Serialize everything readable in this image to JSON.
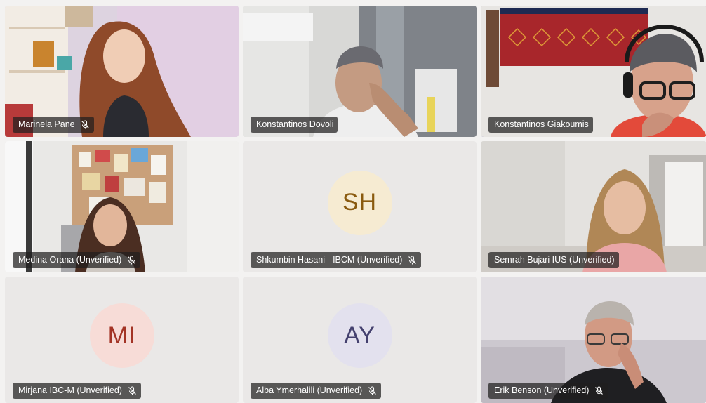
{
  "participants": [
    {
      "name": "Marinela Pane",
      "muted": true
    },
    {
      "name": "Konstantinos Dovoli",
      "muted": false
    },
    {
      "name": "Konstantinos Giakoumis",
      "muted": false,
      "active_speaker": true
    },
    {
      "name": "Medina Orana (Unverified)",
      "muted": true
    },
    {
      "name": "Shkumbin Hasani - IBCM (Unverified)",
      "muted": true,
      "initials": "SH",
      "avatar_bg": "#f6ebd2",
      "avatar_fg": "#8a5a0f"
    },
    {
      "name": "Semrah Bujari IUS (Unverified)",
      "muted": false
    },
    {
      "name": "Mirjana IBC-M (Unverified)",
      "muted": true,
      "initials": "MI",
      "avatar_bg": "#f7dcd7",
      "avatar_fg": "#a33425"
    },
    {
      "name": "Alba Ymerhalili (Unverified)",
      "muted": true,
      "initials": "AY",
      "avatar_bg": "#e3e1ee",
      "avatar_fg": "#44406e"
    },
    {
      "name": "Erik Benson (Unverified)",
      "muted": true
    }
  ],
  "icons": {
    "muted": "mic-off-icon"
  },
  "colors": {
    "active_border": "#6264a7",
    "label_bg": "#201f1f"
  }
}
